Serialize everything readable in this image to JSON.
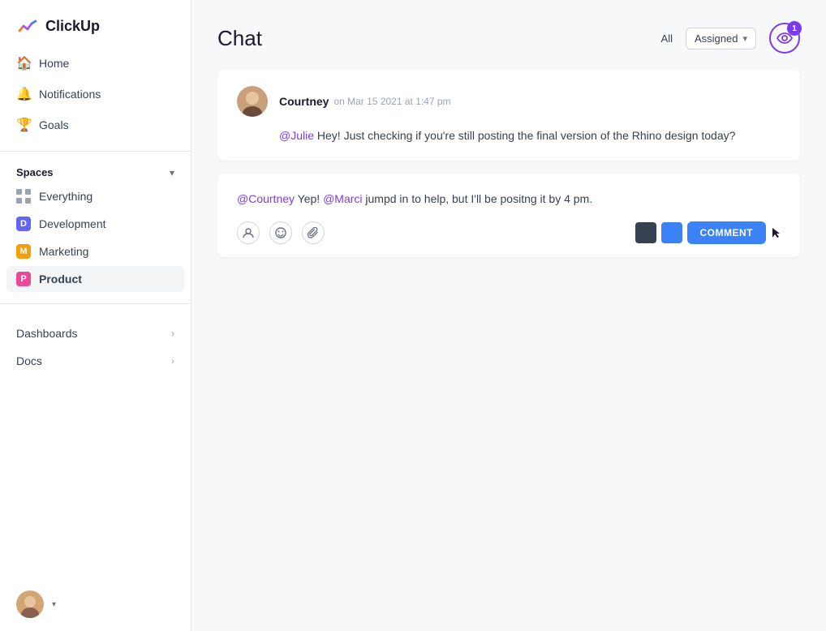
{
  "app": {
    "logo_text": "ClickUp"
  },
  "sidebar": {
    "nav_items": [
      {
        "id": "home",
        "label": "Home",
        "icon": "🏠"
      },
      {
        "id": "notifications",
        "label": "Notifications",
        "icon": "🔔"
      },
      {
        "id": "goals",
        "label": "Goals",
        "icon": "🏆"
      }
    ],
    "spaces_label": "Spaces",
    "space_items": [
      {
        "id": "everything",
        "label": "Everything",
        "color": null
      },
      {
        "id": "development",
        "label": "Development",
        "color": "#6366f1",
        "letter": "D"
      },
      {
        "id": "marketing",
        "label": "Marketing",
        "color": "#f59e0b",
        "letter": "M"
      },
      {
        "id": "product",
        "label": "Product",
        "color": "#ec4899",
        "letter": "P"
      }
    ],
    "section_items": [
      {
        "id": "dashboards",
        "label": "Dashboards"
      },
      {
        "id": "docs",
        "label": "Docs"
      }
    ]
  },
  "header": {
    "title": "Chat",
    "filter_all": "All",
    "filter_assigned": "Assigned",
    "badge_count": "1"
  },
  "messages": [
    {
      "id": "msg1",
      "author": "Courtney",
      "time": "on Mar 15 2021 at 1:47 pm",
      "text_mention": "@Julie",
      "text_body": " Hey! Just checking if you're still posting the final version of the Rhino design today?"
    }
  ],
  "reply": {
    "mention1": "@Courtney",
    "text1": " Yep! ",
    "mention2": "@Marci",
    "text2": " jumpd in to help, but I'll be positng it by 4 pm."
  },
  "toolbar": {
    "comment_label": "COMMENT"
  }
}
